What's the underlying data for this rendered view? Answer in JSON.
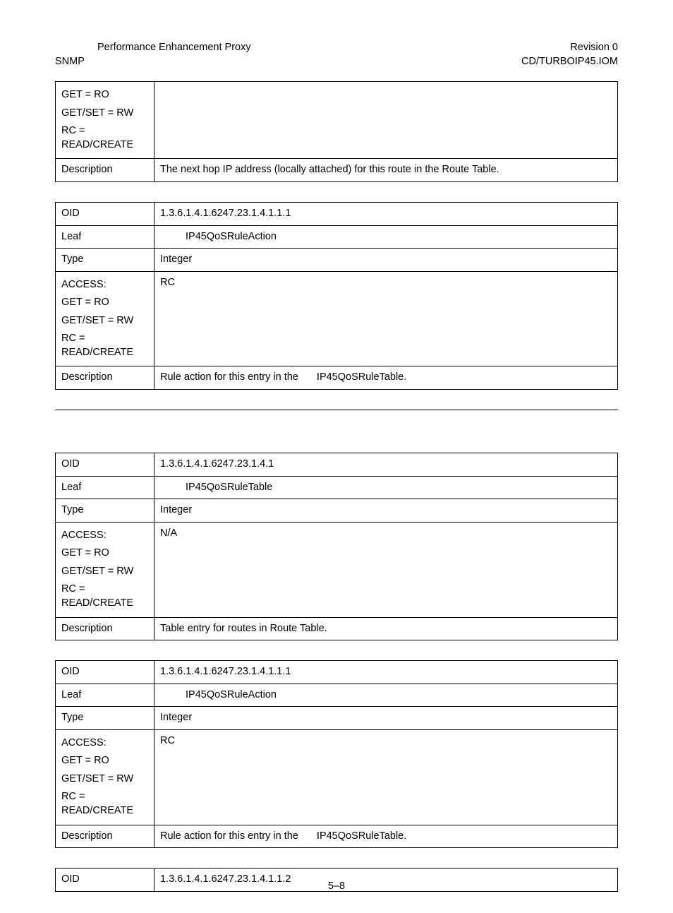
{
  "header": {
    "left1": "Performance Enhancement Proxy",
    "left2": "SNMP",
    "right1": "Revision 0",
    "right2": "CD/TURBOIP45.IOM"
  },
  "label": {
    "oid": "OID",
    "leaf": "Leaf",
    "type": "Type",
    "access": "ACCESS:",
    "get": "GET = RO",
    "getset": "GET/SET = RW",
    "rc": "RC = READ/CREATE",
    "desc": "Description"
  },
  "t1": {
    "desc": "The next hop IP address (locally attached) for this route in the Route Table."
  },
  "t2": {
    "oid": "1.3.6.1.4.1.6247.23.1.4.1.1.1",
    "leaf": "IP45QoSRuleAction",
    "type": "Integer",
    "access": "RC",
    "desc_a": "Rule action for this entry in the",
    "desc_b": "IP45QoSRuleTable."
  },
  "t3": {
    "oid": "1.3.6.1.4.1.6247.23.1.4.1",
    "leaf": "IP45QoSRuleTable",
    "type": "Integer",
    "access": "N/A",
    "desc": "Table entry for routes in Route Table."
  },
  "t4": {
    "oid": "1.3.6.1.4.1.6247.23.1.4.1.1.1",
    "leaf": "IP45QoSRuleAction",
    "type": "Integer",
    "access": "RC",
    "desc_a": "Rule action for this entry in the",
    "desc_b": "IP45QoSRuleTable."
  },
  "t5": {
    "oid": "1.3.6.1.4.1.6247.23.1.4.1.1.2"
  },
  "pagenum": "5–8"
}
